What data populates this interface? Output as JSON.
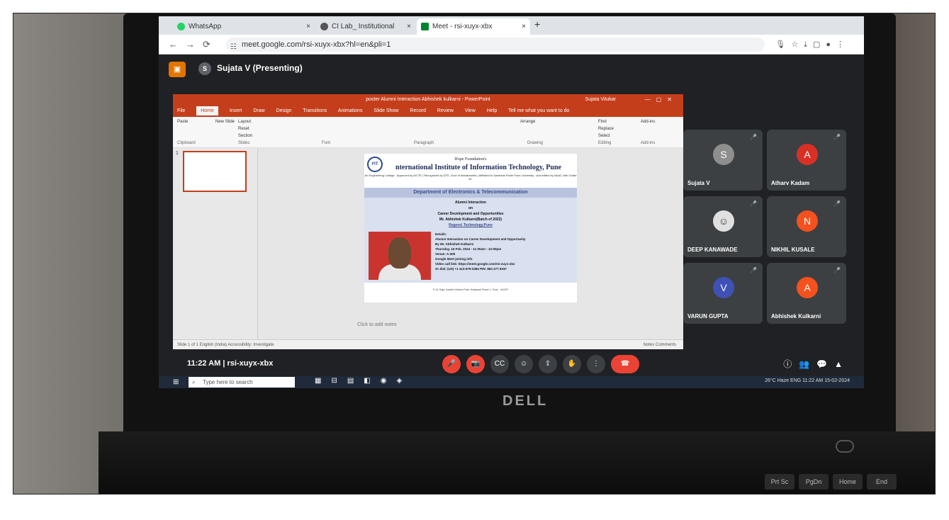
{
  "browser": {
    "tabs": [
      {
        "title": "WhatsApp",
        "close": "×"
      },
      {
        "title": "CI Lab_ Institutional training_/",
        "close": "×"
      },
      {
        "title": "Meet - rsi-xuyx-xbx",
        "close": "×"
      }
    ],
    "new_tab": "+",
    "url": "meet.google.com/rsi-xuyx-xbx?hl=en&pli=1"
  },
  "meet": {
    "presenter": "Sujata V (Presenting)",
    "presenter_initial": "S",
    "time": "11:22 AM",
    "separator": "|",
    "meeting_code": "rsi-xuyx-xbx",
    "participants": [
      {
        "name": "Sujata V",
        "initial": "S",
        "color": "#8e8e8e"
      },
      {
        "name": "Atharv Kadam",
        "initial": "A",
        "color": "#d93025"
      },
      {
        "name": "DEEP KANAWADE",
        "initial": "☺",
        "color": "#e0e0e0"
      },
      {
        "name": "NIKHIL KUSALE",
        "initial": "N",
        "color": "#f4511e"
      },
      {
        "name": "VARUN GUPTA",
        "initial": "V",
        "color": "#3f51b5"
      },
      {
        "name": "Abhishek Kulkarni",
        "initial": "A",
        "color": "#f4511e"
      }
    ]
  },
  "ppt": {
    "title": "poster Alumni Interaction Abhishek kulkarni - PowerPoint",
    "user": "Sujata Vitukar",
    "menu": [
      "File",
      "Home",
      "Insert",
      "Draw",
      "Design",
      "Transitions",
      "Animations",
      "Slide Show",
      "Record",
      "Review",
      "View",
      "Help",
      "Tell me what you want to do"
    ],
    "ribbon_groups": [
      "Clipboard",
      "Slides",
      "Font",
      "Paragraph",
      "Drawing",
      "Editing",
      "Add-ins"
    ],
    "ribbon_buttons": [
      "Paste",
      "New Slide",
      "Layout",
      "Reset",
      "Section",
      "Arrange",
      "Find",
      "Replace",
      "Select",
      "Add-ins"
    ],
    "slide_number": "1",
    "notes_placeholder": "Click to add notes",
    "status_left": "Slide 1 of 1   English (India)   Accessibility: Investigate",
    "status_right": "Notes   Comments"
  },
  "slide": {
    "org_line1": "Hope Foundation's",
    "org_line2": "nternational Institute of Information Technology, Pune",
    "org_line3": "An Engineering College · Approved by AICTE | Recognized by DTE, Govt of Maharashtra | Affiliated to Savitribai Phule Pune University · Accredited by NAAC with Grade B+",
    "logo_text": "I²IT",
    "department": "Department of Electronics & Telecommunication",
    "event_lines": [
      "Alumni Interaction",
      "on",
      "Career Development and Opportunities",
      "Mr. Abhishek Kulkarni(Batch of 2022)",
      "Regenci Technology,Pune"
    ],
    "details": [
      "Details:",
      "Alumni Interaction on Career Development and Opportunity",
      "By Mr. Abhishek Kulkarni",
      "Thursday, 15 Feb. 2024 - 11:00am - 12:00pm",
      "Venue: A-305",
      "Google Meet joining info",
      "Video call link: https://meet.google.com/rsi-xuyx-xbx",
      "Or dial: (US) +1 413-679-2384 PIN: 864 277 833#"
    ],
    "footer": "P-14, Rajiv Gandhi Infotech Park, Hinjawadi Phase 1, Pune - 411057"
  },
  "taskbar": {
    "search_placeholder": "Type here to search",
    "weather": "26°C Haze",
    "clock_time": "11:22 AM",
    "clock_date": "15-02-2024",
    "lang": "ENG"
  },
  "hardware": {
    "brand": "DELL",
    "keys": [
      "Prt Sc",
      "PgDn",
      "Home",
      "End"
    ]
  }
}
